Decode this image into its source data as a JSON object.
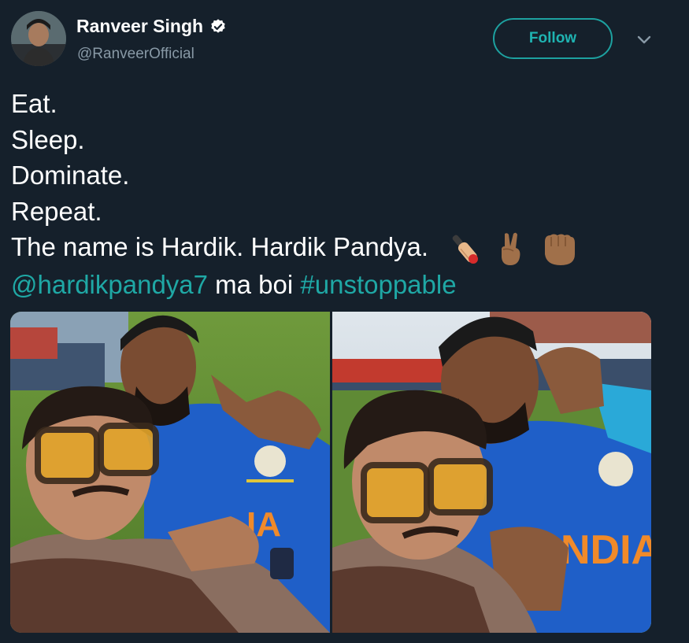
{
  "author": {
    "display_name": "Ranveer Singh",
    "handle": "@RanveerOfficial",
    "verified": true,
    "avatar_icon": "profile-photo"
  },
  "actions": {
    "follow_label": "Follow",
    "more_icon": "chevron-down-icon"
  },
  "tweet": {
    "lines": [
      "Eat.",
      "Sleep.",
      "Dominate.",
      "Repeat.",
      "The name is Hardik. Hardik Pandya."
    ],
    "emojis": [
      "cricket-bat-icon",
      "victory-hand-icon",
      "raised-fist-icon"
    ],
    "mention": "@hardikpandya7",
    "middle_text": " ma boi ",
    "hashtag": "#unstoppable"
  },
  "media": {
    "photos": [
      {
        "jersey_text": "IA"
      },
      {
        "jersey_text": "NDIA"
      }
    ]
  },
  "colors": {
    "background": "#15202b",
    "accent": "#1fa8a5",
    "secondary_text": "#8899a6"
  }
}
